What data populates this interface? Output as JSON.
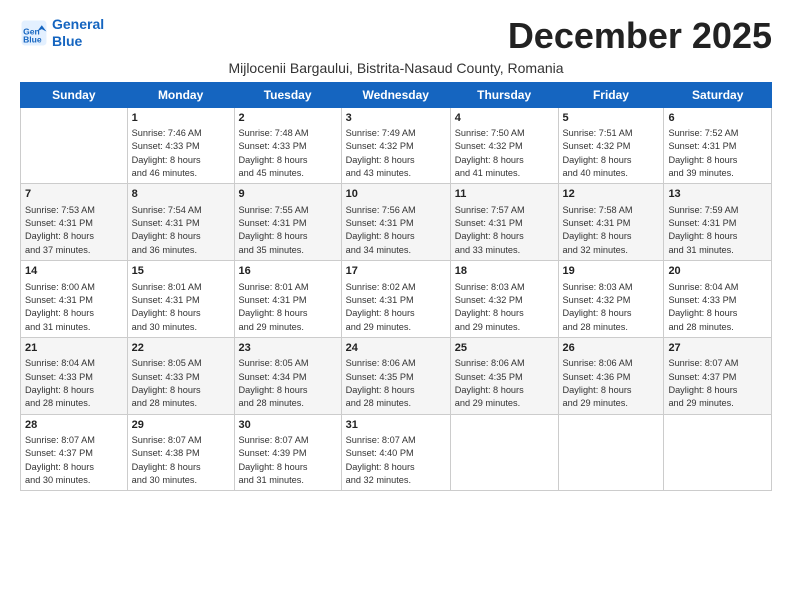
{
  "logo": {
    "line1": "General",
    "line2": "Blue"
  },
  "title": "December 2025",
  "subtitle": "Mijlocenii Bargaului, Bistrita-Nasaud County, Romania",
  "days_header": [
    "Sunday",
    "Monday",
    "Tuesday",
    "Wednesday",
    "Thursday",
    "Friday",
    "Saturday"
  ],
  "weeks": [
    [
      {
        "day": "",
        "text": ""
      },
      {
        "day": "1",
        "text": "Sunrise: 7:46 AM\nSunset: 4:33 PM\nDaylight: 8 hours\nand 46 minutes."
      },
      {
        "day": "2",
        "text": "Sunrise: 7:48 AM\nSunset: 4:33 PM\nDaylight: 8 hours\nand 45 minutes."
      },
      {
        "day": "3",
        "text": "Sunrise: 7:49 AM\nSunset: 4:32 PM\nDaylight: 8 hours\nand 43 minutes."
      },
      {
        "day": "4",
        "text": "Sunrise: 7:50 AM\nSunset: 4:32 PM\nDaylight: 8 hours\nand 41 minutes."
      },
      {
        "day": "5",
        "text": "Sunrise: 7:51 AM\nSunset: 4:32 PM\nDaylight: 8 hours\nand 40 minutes."
      },
      {
        "day": "6",
        "text": "Sunrise: 7:52 AM\nSunset: 4:31 PM\nDaylight: 8 hours\nand 39 minutes."
      }
    ],
    [
      {
        "day": "7",
        "text": "Sunrise: 7:53 AM\nSunset: 4:31 PM\nDaylight: 8 hours\nand 37 minutes."
      },
      {
        "day": "8",
        "text": "Sunrise: 7:54 AM\nSunset: 4:31 PM\nDaylight: 8 hours\nand 36 minutes."
      },
      {
        "day": "9",
        "text": "Sunrise: 7:55 AM\nSunset: 4:31 PM\nDaylight: 8 hours\nand 35 minutes."
      },
      {
        "day": "10",
        "text": "Sunrise: 7:56 AM\nSunset: 4:31 PM\nDaylight: 8 hours\nand 34 minutes."
      },
      {
        "day": "11",
        "text": "Sunrise: 7:57 AM\nSunset: 4:31 PM\nDaylight: 8 hours\nand 33 minutes."
      },
      {
        "day": "12",
        "text": "Sunrise: 7:58 AM\nSunset: 4:31 PM\nDaylight: 8 hours\nand 32 minutes."
      },
      {
        "day": "13",
        "text": "Sunrise: 7:59 AM\nSunset: 4:31 PM\nDaylight: 8 hours\nand 31 minutes."
      }
    ],
    [
      {
        "day": "14",
        "text": "Sunrise: 8:00 AM\nSunset: 4:31 PM\nDaylight: 8 hours\nand 31 minutes."
      },
      {
        "day": "15",
        "text": "Sunrise: 8:01 AM\nSunset: 4:31 PM\nDaylight: 8 hours\nand 30 minutes."
      },
      {
        "day": "16",
        "text": "Sunrise: 8:01 AM\nSunset: 4:31 PM\nDaylight: 8 hours\nand 29 minutes."
      },
      {
        "day": "17",
        "text": "Sunrise: 8:02 AM\nSunset: 4:31 PM\nDaylight: 8 hours\nand 29 minutes."
      },
      {
        "day": "18",
        "text": "Sunrise: 8:03 AM\nSunset: 4:32 PM\nDaylight: 8 hours\nand 29 minutes."
      },
      {
        "day": "19",
        "text": "Sunrise: 8:03 AM\nSunset: 4:32 PM\nDaylight: 8 hours\nand 28 minutes."
      },
      {
        "day": "20",
        "text": "Sunrise: 8:04 AM\nSunset: 4:33 PM\nDaylight: 8 hours\nand 28 minutes."
      }
    ],
    [
      {
        "day": "21",
        "text": "Sunrise: 8:04 AM\nSunset: 4:33 PM\nDaylight: 8 hours\nand 28 minutes."
      },
      {
        "day": "22",
        "text": "Sunrise: 8:05 AM\nSunset: 4:33 PM\nDaylight: 8 hours\nand 28 minutes."
      },
      {
        "day": "23",
        "text": "Sunrise: 8:05 AM\nSunset: 4:34 PM\nDaylight: 8 hours\nand 28 minutes."
      },
      {
        "day": "24",
        "text": "Sunrise: 8:06 AM\nSunset: 4:35 PM\nDaylight: 8 hours\nand 28 minutes."
      },
      {
        "day": "25",
        "text": "Sunrise: 8:06 AM\nSunset: 4:35 PM\nDaylight: 8 hours\nand 29 minutes."
      },
      {
        "day": "26",
        "text": "Sunrise: 8:06 AM\nSunset: 4:36 PM\nDaylight: 8 hours\nand 29 minutes."
      },
      {
        "day": "27",
        "text": "Sunrise: 8:07 AM\nSunset: 4:37 PM\nDaylight: 8 hours\nand 29 minutes."
      }
    ],
    [
      {
        "day": "28",
        "text": "Sunrise: 8:07 AM\nSunset: 4:37 PM\nDaylight: 8 hours\nand 30 minutes."
      },
      {
        "day": "29",
        "text": "Sunrise: 8:07 AM\nSunset: 4:38 PM\nDaylight: 8 hours\nand 30 minutes."
      },
      {
        "day": "30",
        "text": "Sunrise: 8:07 AM\nSunset: 4:39 PM\nDaylight: 8 hours\nand 31 minutes."
      },
      {
        "day": "31",
        "text": "Sunrise: 8:07 AM\nSunset: 4:40 PM\nDaylight: 8 hours\nand 32 minutes."
      },
      {
        "day": "",
        "text": ""
      },
      {
        "day": "",
        "text": ""
      },
      {
        "day": "",
        "text": ""
      }
    ]
  ]
}
